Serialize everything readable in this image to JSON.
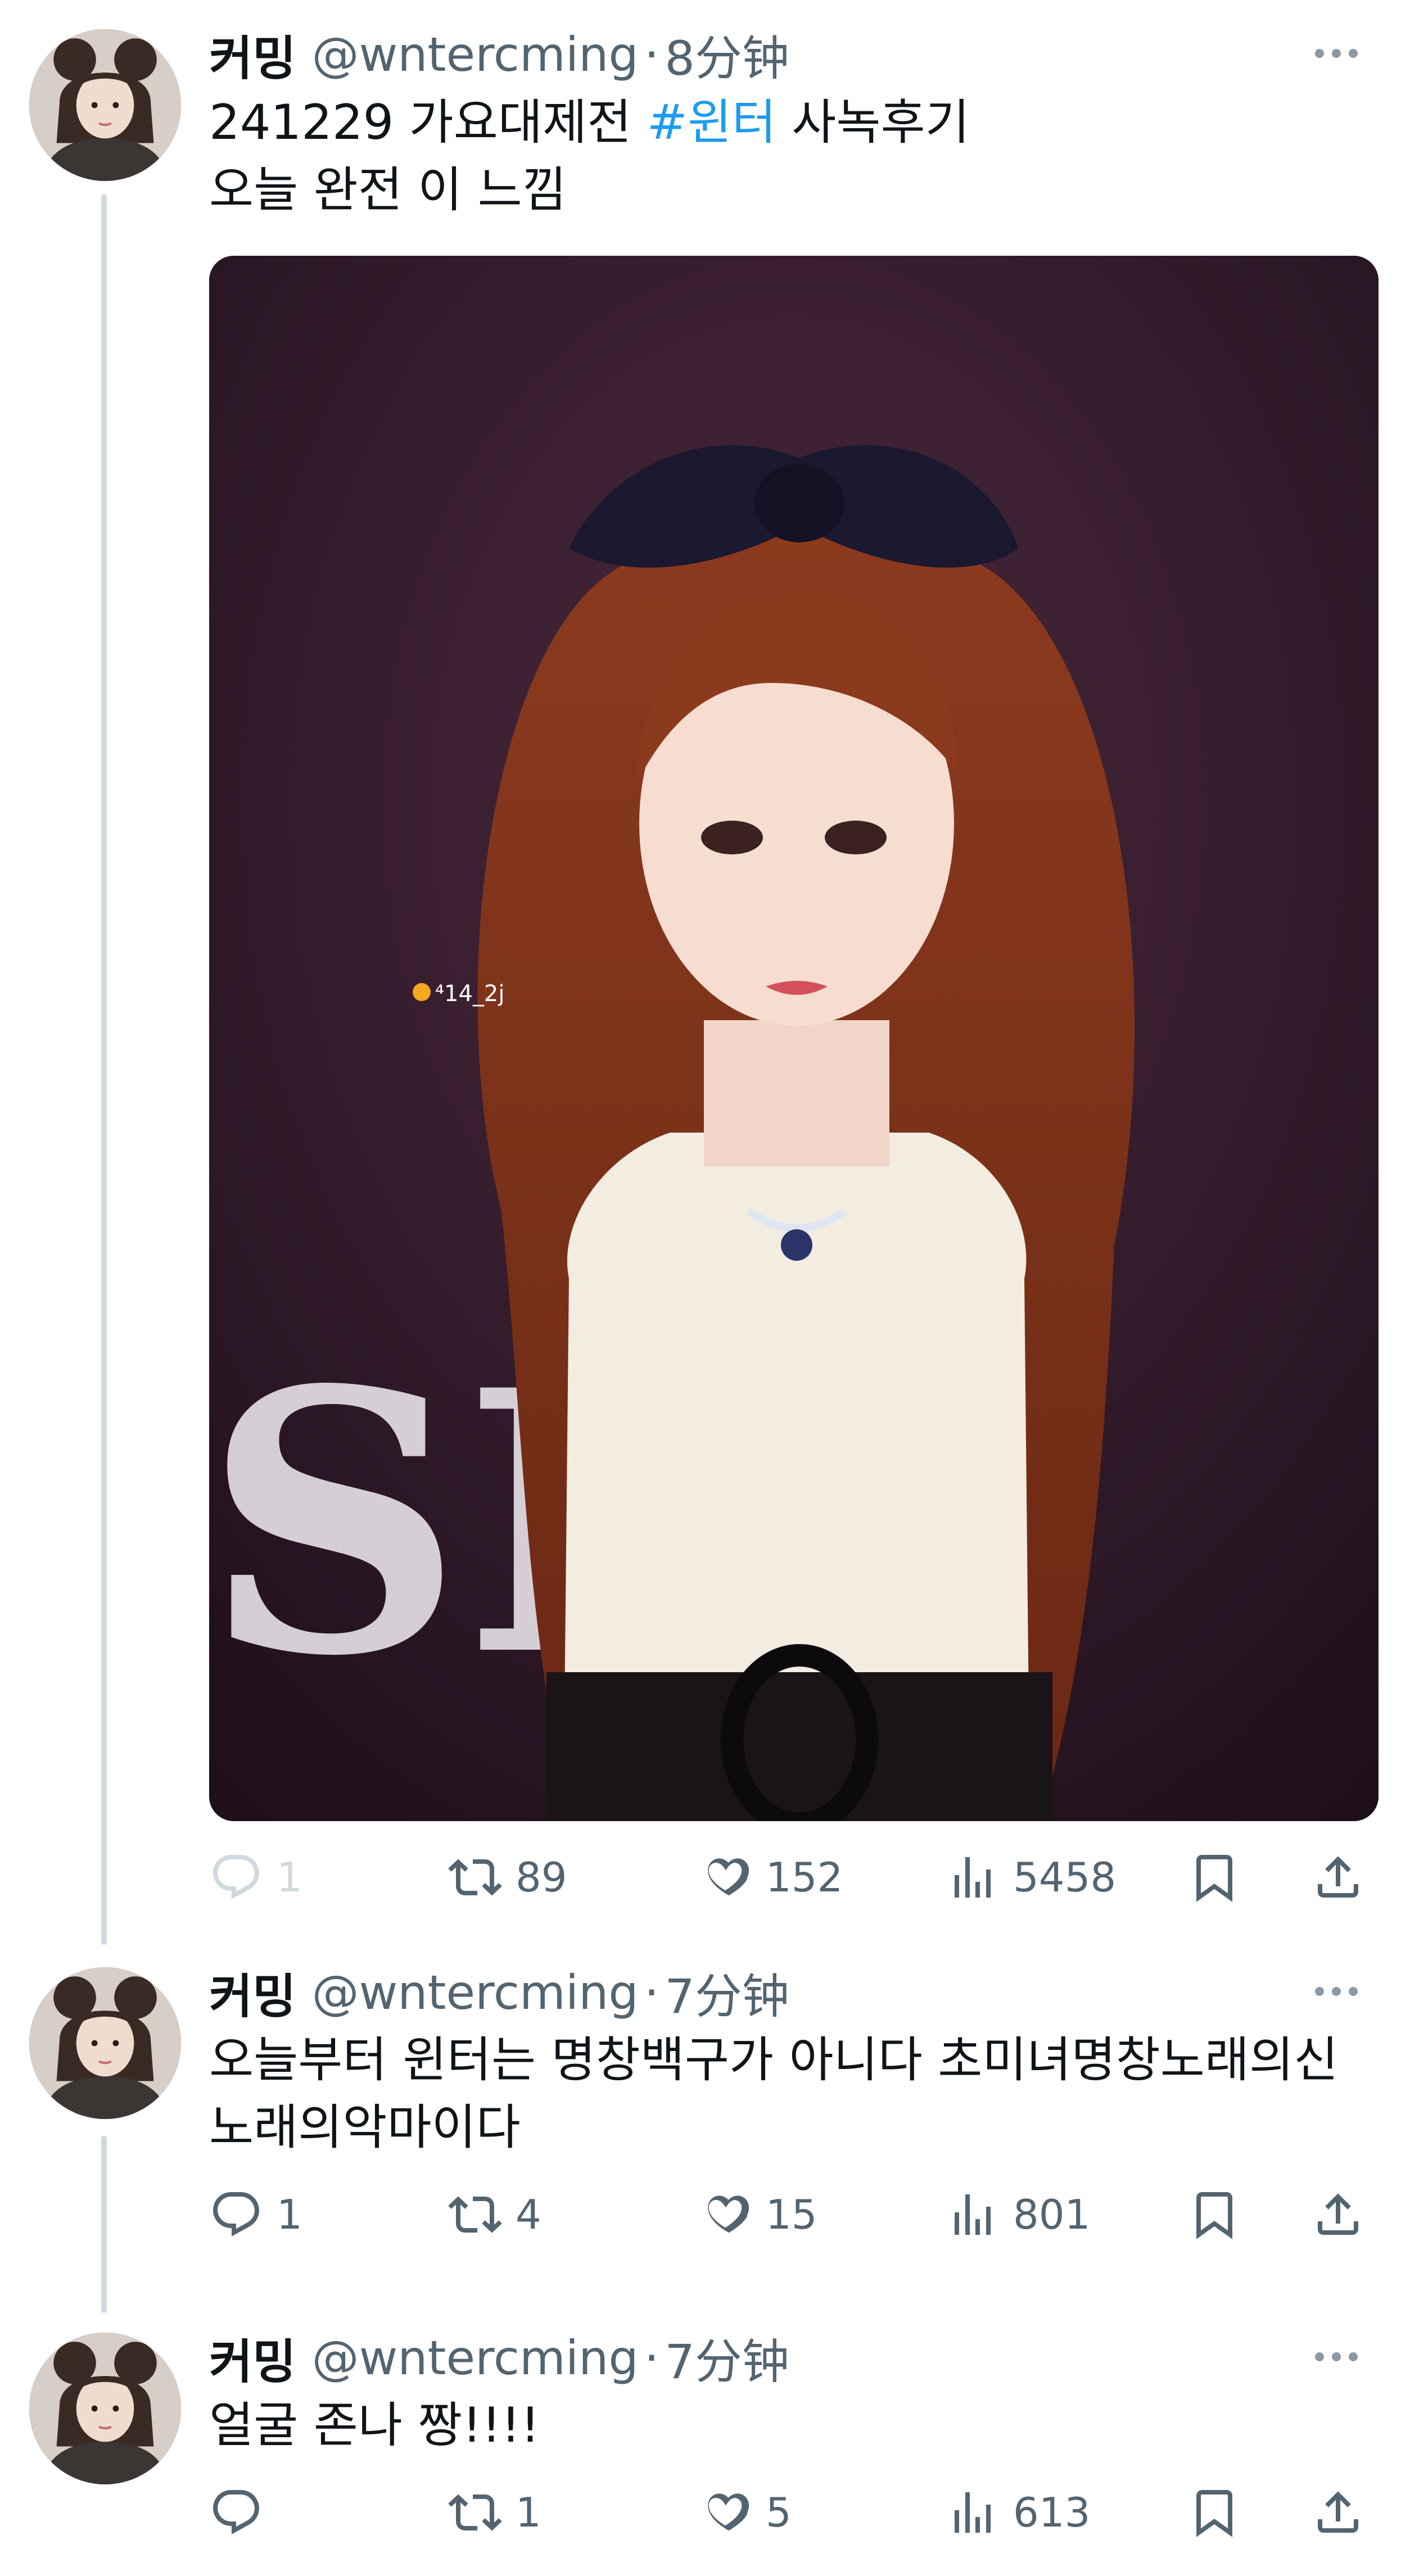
{
  "tweets": [
    {
      "display_name": "커밍",
      "handle": "@wntercming",
      "separator": "·",
      "time": "8分钟",
      "text_before_hashtag": "241229 가요대제전 ",
      "hashtag": "#윈터",
      "text_after_hashtag": " 사녹후기",
      "text_line2": "오늘 완전 이 느낌",
      "media_watermark": "⁴14_2j",
      "media_backdrop_text": "SI",
      "counts": {
        "replies": "1",
        "reposts": "89",
        "likes": "152",
        "views": "5458"
      }
    },
    {
      "display_name": "커밍",
      "handle": "@wntercming",
      "separator": "·",
      "time": "7分钟",
      "text_line1": "오늘부터 윈터는 명창백구가 아니다 초미녀명창노래의신",
      "text_line2": "노래의악마이다",
      "counts": {
        "replies": "1",
        "reposts": "4",
        "likes": "15",
        "views": "801"
      }
    },
    {
      "display_name": "커밍",
      "handle": "@wntercming",
      "separator": "·",
      "time": "7分钟",
      "text_line1": "얼굴 존나 짱!!!!",
      "counts": {
        "replies": "",
        "reposts": "1",
        "likes": "5",
        "views": "613"
      }
    }
  ],
  "icons": [
    "reply-icon",
    "repost-icon",
    "like-icon",
    "views-icon",
    "bookmark-icon",
    "share-icon",
    "more-icon"
  ],
  "colors": {
    "text": "#0f1419",
    "secondary": "#536471",
    "hashtag": "#1d9bf0",
    "thread_line": "#cfd9de"
  }
}
